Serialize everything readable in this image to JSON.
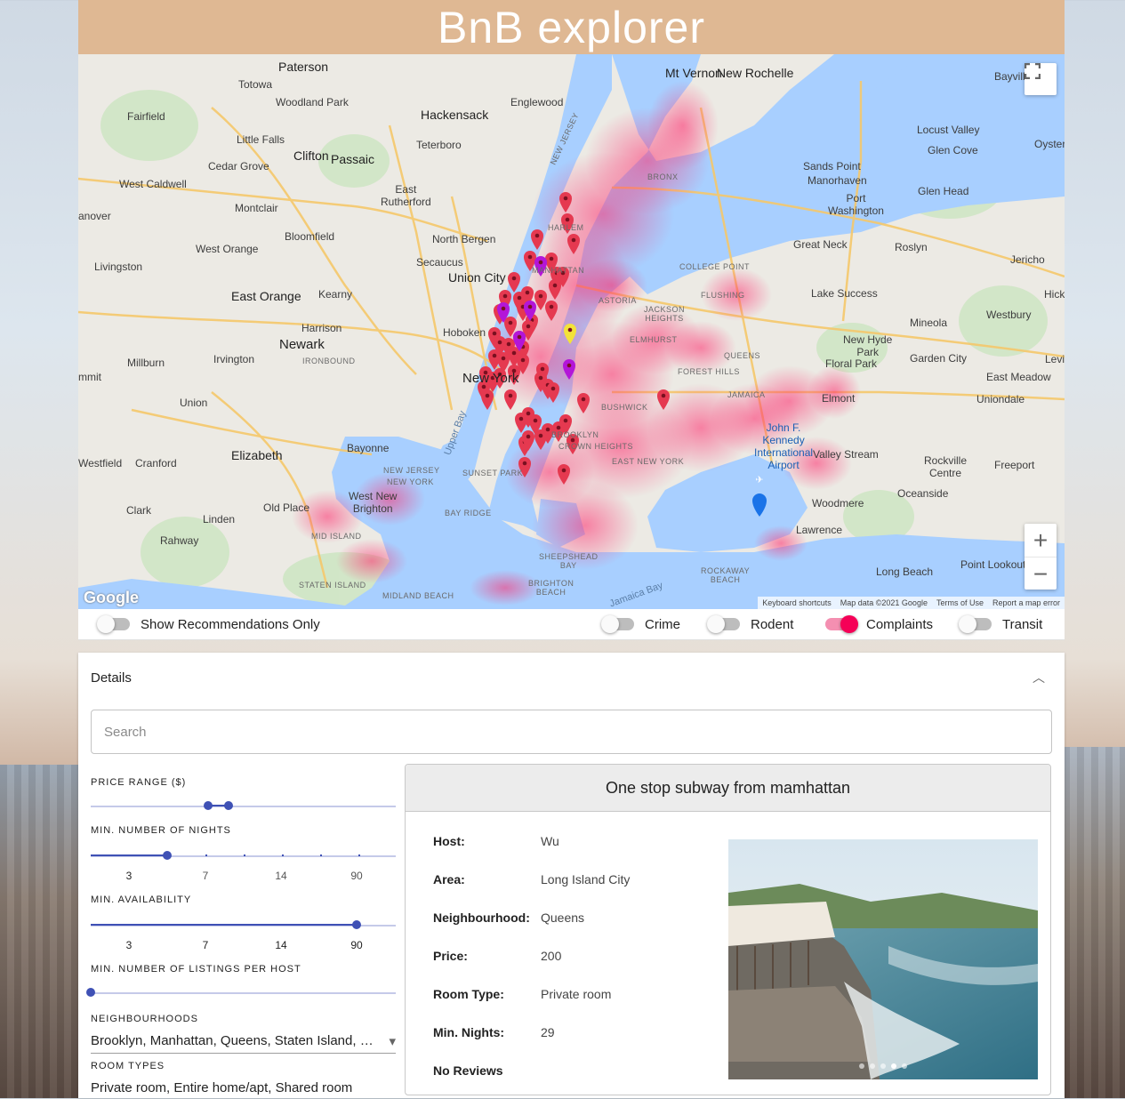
{
  "app": {
    "title": "BnB explorer"
  },
  "map": {
    "labels": {
      "paterson": "Paterson",
      "totowa": "Totowa",
      "woodland_park": "Woodland\nPark",
      "hackensack": "Hackensack",
      "englewood": "Englewood",
      "mt_vernon": "Mt Vernon",
      "new_rochelle": "New Rochelle",
      "bayville": "Bayville",
      "fairfield": "Fairfield",
      "little_falls": "Little Falls",
      "teterboro": "Teterboro",
      "locust_valley": "Locust Valley",
      "oyster_bay": "Oyster Ba",
      "cedar_grove": "Cedar Grove",
      "clifton": "Clifton",
      "passaic": "Passaic",
      "glen_cove": "Glen Cove",
      "sands_point": "Sands Point",
      "manorhaven": "Manorhaven",
      "west_caldwell": "West Caldwell",
      "east_rutherford": "East\nRutherford",
      "bronx": "BRONX",
      "glen_head": "Glen Head",
      "port_washington": "Port\nWashington",
      "hanover": "anover",
      "montclair": "Montclair",
      "bloomfield": "Bloomfield",
      "north_bergen": "North Bergen",
      "harlem": "HARLEM",
      "great_neck": "Great Neck",
      "roslyn": "Roslyn",
      "jericho": "Jericho",
      "west_orange": "West Orange",
      "livingston": "Livingston",
      "secaucus": "Secaucus",
      "manhattan": "MANHATTAN",
      "college_point": "COLLEGE POINT",
      "flushing": "FLUSHING",
      "east_orange": "East Orange",
      "kearny": "Kearny",
      "union_city": "Union City",
      "astoria": "ASTORIA",
      "lake_success": "Lake Success",
      "hicksville": "Hicksv",
      "harrison": "Harrison",
      "newark": "Newark",
      "jackson_heights": "JACKSON\nHEIGHTS",
      "mineola": "Mineola",
      "westbury": "Westbury",
      "hoboken": "Hoboken",
      "elmhurst": "ELMHURST",
      "new_hyde_park": "New Hyde\nPark",
      "millburn": "Millburn",
      "irvington": "Irvington",
      "ironbound": "IRONBOUND",
      "forest_hills": "FOREST HILLS",
      "queens": "QUEENS",
      "floral_park": "Floral Park",
      "garden_city": "Garden City",
      "levittown": "Levi",
      "summit": "mmit",
      "new_york": "New York",
      "east_meadow": "East Meadow",
      "union": "Union",
      "bushwick": "BUSHWICK",
      "jamaica": "JAMAICA",
      "elmont": "Elmont",
      "uniondale": "Uniondale",
      "brooklyn": "BROOKLYN",
      "crown_heights": "CROWN HEIGHTS",
      "jfk": "John F.\nKennedy\nInternational\nAirport",
      "bayonne": "Bayonne",
      "elizabeth": "Elizabeth",
      "westfield": "Westfield",
      "cranford": "Cranford",
      "east_new_york": "EAST NEW YORK",
      "valley_stream": "Valley Stream",
      "rockville_centre": "Rockville\nCentre",
      "freeport": "Freeport",
      "new_jersey": "NEW JERSEY",
      "new_york_state": "NEW YORK",
      "sunset_park": "SUNSET PARK",
      "clark": "Clark",
      "west_new_brighton": "West New\nBrighton",
      "oceanside": "Oceanside",
      "woodmere": "Woodmere",
      "bay_ridge": "BAY RIDGE",
      "old_place": "Old Place",
      "linden": "Linden",
      "mid_island": "MID ISLAND",
      "lawrence": "Lawrence",
      "rahway": "Rahway",
      "sheepshead_bay": "SHEEPSHEAD\nBAY",
      "point_lookout": "Point Lookout",
      "long_beach": "Long Beach",
      "rockaway_beach": "ROCKAWAY\nBEACH",
      "staten_island": "STATEN ISLAND",
      "midland_beach": "MIDLAND BEACH",
      "brighton_beach": "BRIGHTON\nBEACH",
      "upper_bay": "Upper Bay",
      "jamaica_bay": "Jamaica Bay",
      "new_jersey_2": "NEW JERSEY"
    },
    "controls": {
      "fullscreen_icon": "fullscreen-icon",
      "zoom_in": "+",
      "zoom_out": "−"
    },
    "google_logo": "Google",
    "attribution": {
      "shortcuts": "Keyboard shortcuts",
      "data": "Map data ©2021 Google",
      "terms": "Terms of Use",
      "report": "Report a map error"
    },
    "colors": {
      "heat": "#ff2a6d",
      "marker_red": "#e53950",
      "marker_purple": "#b316d8",
      "marker_yellow": "#f3e23a",
      "water": "#a8cfff"
    }
  },
  "toggles": {
    "recommendations": {
      "label": "Show Recommendations Only",
      "on": false
    },
    "crime": {
      "label": "Crime",
      "on": false
    },
    "rodent": {
      "label": "Rodent",
      "on": false
    },
    "complaints": {
      "label": "Complaints",
      "on": true
    },
    "transit": {
      "label": "Transit",
      "on": false
    }
  },
  "details": {
    "title": "Details",
    "search_placeholder": "Search",
    "filters": {
      "price_range": {
        "label": "Price range ($)"
      },
      "min_nights": {
        "label": "Min. number of nights",
        "marks": [
          "3",
          "7",
          "14",
          "90"
        ]
      },
      "min_availability": {
        "label": "Min. availability",
        "marks": [
          "3",
          "7",
          "14",
          "90"
        ]
      },
      "min_listings": {
        "label": "Min. number of listings per host"
      },
      "neighbourhoods": {
        "label": "Neighbourhoods",
        "value": "Brooklyn, Manhattan, Queens, Staten Island, Bronx"
      },
      "room_types": {
        "label": "Room types",
        "value": "Private room, Entire home/apt, Shared room"
      }
    },
    "listing": {
      "title": "One stop subway from mamhattan",
      "host_label": "Host:",
      "host": "Wu",
      "area_label": "Area:",
      "area": "Long Island City",
      "neighbourhood_label": "Neighbourhood:",
      "neighbourhood": "Queens",
      "price_label": "Price:",
      "price": "200",
      "room_type_label": "Room Type:",
      "room_type": "Private room",
      "min_nights_label": "Min. Nights:",
      "min_nights": "29",
      "reviews": "No Reviews"
    }
  }
}
